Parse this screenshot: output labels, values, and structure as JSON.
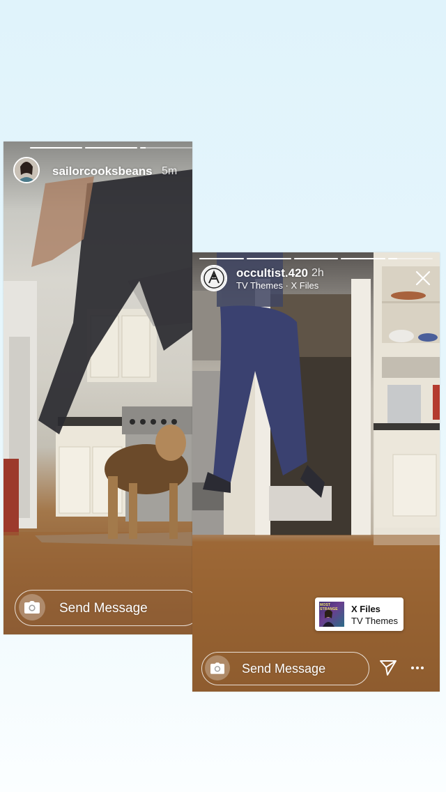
{
  "stories": [
    {
      "username": "sailorcooksbeans",
      "time": "5m",
      "progress": [
        1,
        1,
        0.1
      ],
      "message_placeholder": "Send Message"
    },
    {
      "username": "occultist.420",
      "time": "2h",
      "subtitle": "TV Themes · X Files",
      "progress": [
        1,
        1,
        1,
        1,
        0.2
      ],
      "message_placeholder": "Send Message",
      "music": {
        "title": "X Files",
        "artist": "TV Themes",
        "album_art_text": "MOST STRANGE"
      }
    }
  ],
  "icons": {
    "camera": "camera-icon",
    "close": "close-icon",
    "send": "paper-plane-icon",
    "more": "more-dots-icon"
  },
  "colors": {
    "background_top": "#e0f3fb",
    "background_bottom": "#fbfeff",
    "overlay_text": "#ffffff",
    "wood_floor": "#93602f"
  }
}
